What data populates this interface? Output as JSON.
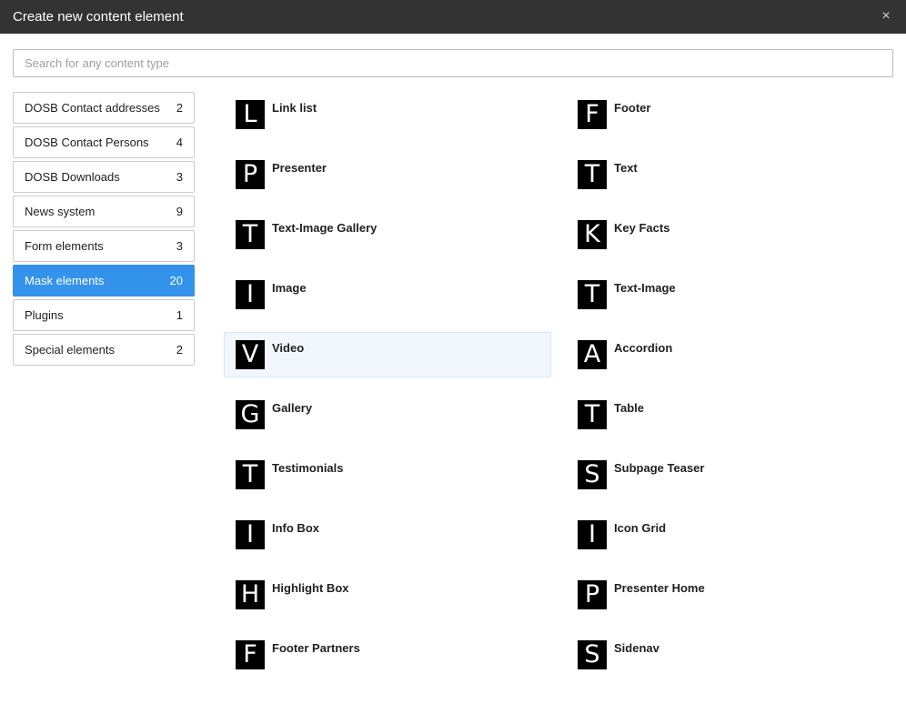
{
  "dialog": {
    "title": "Create new content element",
    "close_glyph": "×"
  },
  "search": {
    "placeholder": "Search for any content type",
    "value": ""
  },
  "categories": [
    {
      "label": "DOSB Contact addresses",
      "count": "2"
    },
    {
      "label": "DOSB Contact Persons",
      "count": "4"
    },
    {
      "label": "DOSB Downloads",
      "count": "3"
    },
    {
      "label": "News system",
      "count": "9"
    },
    {
      "label": "Form elements",
      "count": "3"
    },
    {
      "label": "Mask elements",
      "count": "20",
      "active": true
    },
    {
      "label": "Plugins",
      "count": "1"
    },
    {
      "label": "Special elements",
      "count": "2"
    }
  ],
  "elements": [
    {
      "letter": "L",
      "label": "Link list"
    },
    {
      "letter": "F",
      "label": "Footer"
    },
    {
      "letter": "P",
      "label": "Presenter"
    },
    {
      "letter": "T",
      "label": "Text"
    },
    {
      "letter": "T",
      "label": "Text-Image Gallery"
    },
    {
      "letter": "K",
      "label": "Key Facts"
    },
    {
      "letter": "I",
      "label": "Image"
    },
    {
      "letter": "T",
      "label": "Text-Image"
    },
    {
      "letter": "V",
      "label": "Video",
      "hover": true
    },
    {
      "letter": "A",
      "label": "Accordion"
    },
    {
      "letter": "G",
      "label": "Gallery"
    },
    {
      "letter": "T",
      "label": "Table"
    },
    {
      "letter": "T",
      "label": "Testimonials"
    },
    {
      "letter": "S",
      "label": "Subpage Teaser"
    },
    {
      "letter": "I",
      "label": "Info Box"
    },
    {
      "letter": "I",
      "label": "Icon Grid"
    },
    {
      "letter": "H",
      "label": "Highlight Box"
    },
    {
      "letter": "P",
      "label": "Presenter Home"
    },
    {
      "letter": "F",
      "label": "Footer Partners"
    },
    {
      "letter": "S",
      "label": "Sidenav"
    }
  ],
  "colors": {
    "titlebar": "#333333",
    "active_category": "#3393eb",
    "icon_background": "#000000",
    "hover_background": "#f2f7fd"
  }
}
